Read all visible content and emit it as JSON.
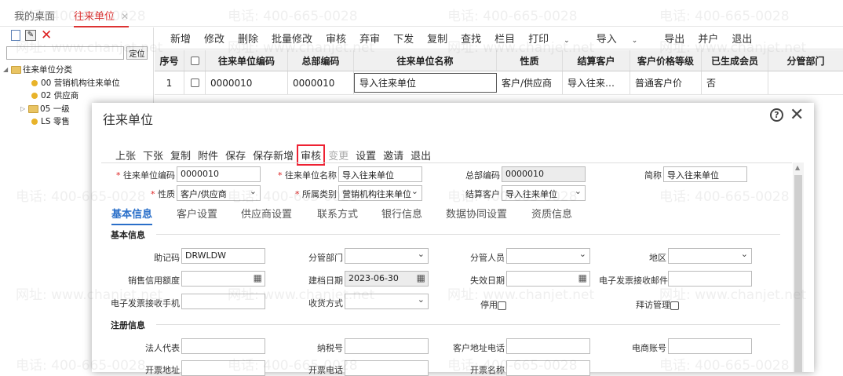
{
  "tabs": [
    {
      "label": "我的桌面"
    },
    {
      "label": "往来单位"
    }
  ],
  "left": {
    "locate_label": "定位",
    "tree": [
      "往来单位分类",
      "00 营销机构往来单位",
      "02 供应商",
      "05 一级",
      "LS 零售"
    ]
  },
  "toolbar": [
    "新增",
    "修改",
    "删除",
    "批量修改",
    "审核",
    "弃审",
    "下发",
    "复制",
    "查找",
    "栏目",
    "打印",
    "导入",
    "导出",
    "并户",
    "退出"
  ],
  "grid": {
    "headers": [
      "序号",
      "",
      "往来单位编码",
      "总部编码",
      "往来单位名称",
      "性质",
      "结算客户",
      "客户价格等级",
      "已生成会员",
      "分管部门"
    ],
    "row": [
      "1",
      "",
      "0000010",
      "0000010",
      "导入往来单位",
      "客户/供应商",
      "导入往来…",
      "普通客户价",
      "否",
      ""
    ]
  },
  "modal": {
    "title": "往来单位",
    "toolbar": [
      "上张",
      "下张",
      "复制",
      "附件",
      "保存",
      "保存新增",
      "审核",
      "变更",
      "设置",
      "邀请",
      "退出"
    ],
    "header_fields": {
      "code_label": "往来单位编码",
      "code": "0000010",
      "name_label": "往来单位名称",
      "name": "导入往来单位",
      "hq_label": "总部编码",
      "hq": "0000010",
      "abbr_label": "简称",
      "abbr": "导入往来单位",
      "nature_label": "性质",
      "nature": "客户/供应商",
      "category_label": "所属类别",
      "category": "营销机构往来单位",
      "settle_label": "结算客户",
      "settle": "导入往来单位"
    },
    "subtabs": [
      "基本信息",
      "客户设置",
      "供应商设置",
      "联系方式",
      "银行信息",
      "数据协同设置",
      "资质信息"
    ],
    "basic": {
      "section": "基本信息",
      "mnemonic_label": "助记码",
      "mnemonic": "DRWLDW",
      "dept_label": "分管部门",
      "staff_label": "分管人员",
      "region_label": "地区",
      "credit_label": "销售信用额度",
      "created_label": "建档日期",
      "created": "2023-06-30",
      "expire_label": "失效日期",
      "einv_email_label": "电子发票接收邮件",
      "einv_phone_label": "电子发票接收手机",
      "collect_label": "收货方式",
      "disabled_label": "停用",
      "visit_label": "拜访管理"
    },
    "reg": {
      "section": "注册信息",
      "legal_label": "法人代表",
      "tax_label": "纳税号",
      "addr_phone_label": "客户地址电话",
      "ecom_label": "电商账号",
      "inv_addr_label": "开票地址",
      "inv_phone_label": "开票电话",
      "inv_name_label": "开票名称"
    }
  },
  "watermark": {
    "phone": "电话: 400-665-0028",
    "site": "网址: www.chanjet.net"
  }
}
